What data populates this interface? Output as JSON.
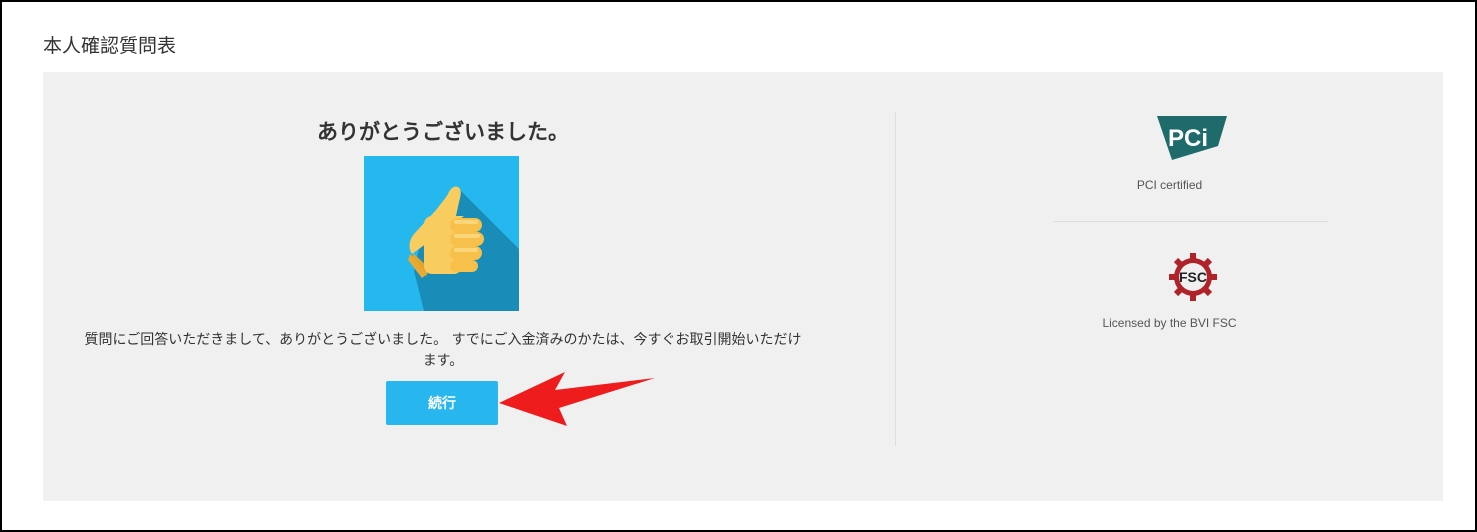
{
  "page": {
    "title": "本人確認質問表"
  },
  "confirmation": {
    "heading": "ありがとうございました。",
    "message": "質問にご回答いただきまして、ありがとうございました。 すでにご入金済みのかたは、今すぐお取引開始いただけます。",
    "continue_label": "続行",
    "image_icon": "thumbs-up-icon"
  },
  "certifications": [
    {
      "icon": "pci-logo-icon",
      "logo_text": "PCi",
      "label": "PCI certified"
    },
    {
      "icon": "fsc-logo-icon",
      "logo_text": "FSC",
      "label": "Licensed by the BVI FSC"
    }
  ],
  "colors": {
    "panel_background": "#f0f0f0",
    "button": "#27b6ee",
    "thumb_tile": "#25b8ef",
    "pci_brand": "#1f6b6b",
    "fsc_brand": "#b0222a",
    "annotation_arrow": "#ee1c1c"
  }
}
